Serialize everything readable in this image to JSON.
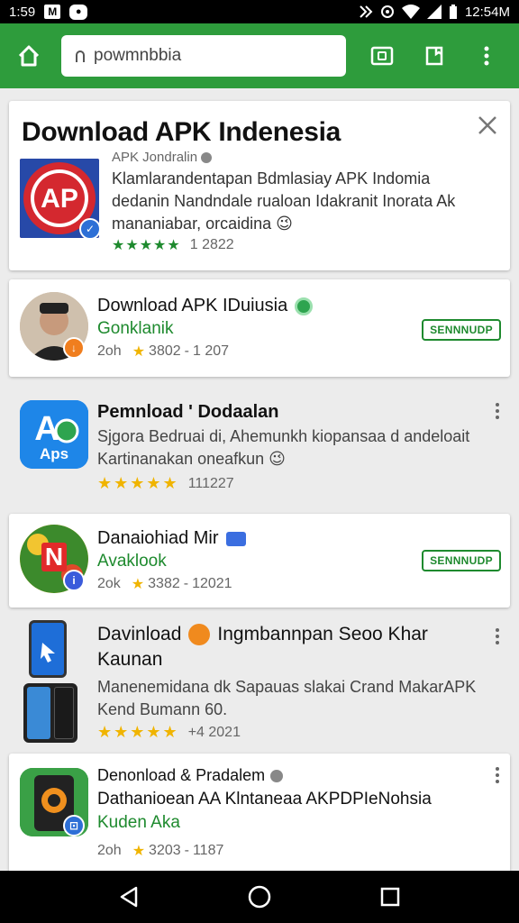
{
  "status_bar": {
    "time_left": "1:59",
    "icon_box": "M",
    "icon_round": "●",
    "time_right": "12:54M"
  },
  "toolbar": {
    "url": "powmnbbia"
  },
  "header_card": {
    "title": "Download APK Indenesia",
    "publisher": "APK Jondralin",
    "description": "Klamlarandentapan Bdmlasiay APK Indomia dedanin Nandndale rualoan Idakranit Inorata Ak mananiabar, orcaidina",
    "emoji": "😉",
    "rating_stars": "★★★★★",
    "rating_count": "1 2822"
  },
  "apps": [
    {
      "name": "Download APK IDuiusia",
      "developer": "Gonklanik",
      "size": "2oh",
      "rating": "3802",
      "count": "1 207",
      "install_label": "SENNNUDP"
    },
    {
      "name": "Pemnload ' Dodaalan",
      "description": "Sjgora Bedruai di, Ahemunkh kiopansaa d andeloait Kartinanakan oneafkun",
      "emoji": "😉",
      "stars": "★★★★★",
      "count": "111227",
      "icon_text": "Aps"
    },
    {
      "name": "Danaiohiad Mir",
      "developer": "Avaklook",
      "size": "2ok",
      "rating": "3382",
      "count": "12021",
      "install_label": "SENNNUDP",
      "icon_letter": "N"
    },
    {
      "name": "Davinload",
      "name_rest": "Ingmbannpan Seoo Khar",
      "name_line2": "Kaunan",
      "description": "Manenemidana dk Sapauas slakai Crand MakarAPK Kend Bumann 60.",
      "stars": "★★★★★",
      "count": "+4 2021"
    },
    {
      "name": "Denonload & Pradalem",
      "subtitle": "Dathanioean AA Klntaneaa AKPDPIeNohsia",
      "developer": "Kuden Aka",
      "size": "2oh",
      "rating": "3203",
      "count": "1187"
    }
  ],
  "nav": {
    "back": "◁",
    "home": "○",
    "recents": "□"
  },
  "colors": {
    "brand_green": "#2e9c3c",
    "text_green": "#1e8a2e",
    "star_yellow": "#f0b400"
  }
}
